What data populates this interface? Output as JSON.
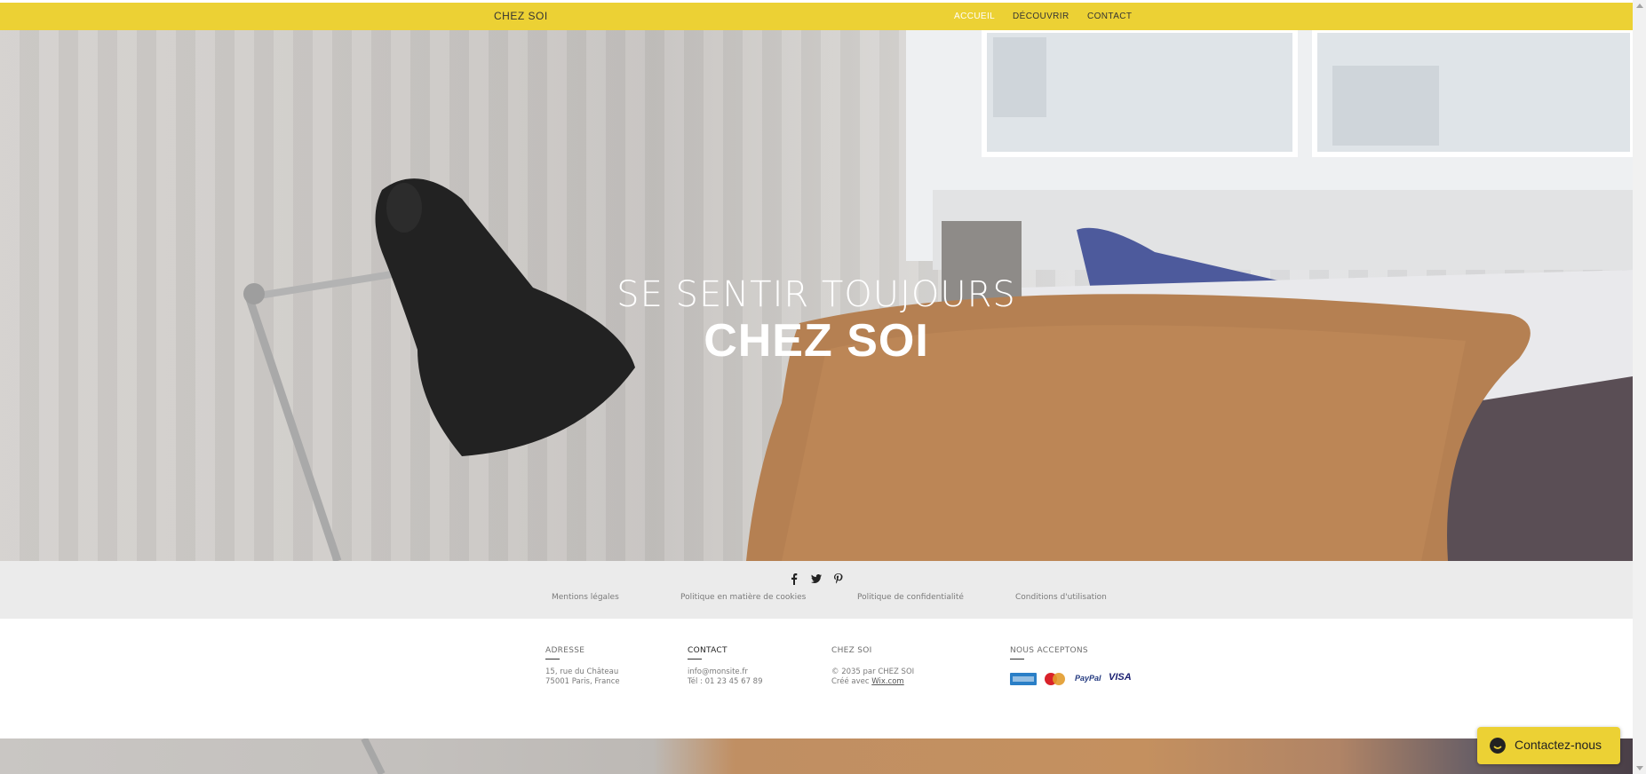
{
  "header": {
    "logo": "CHEZ SOI",
    "nav": [
      {
        "label": "ACCUEIL",
        "active": true
      },
      {
        "label": "DÉCOUVRIR",
        "active": false
      },
      {
        "label": "CONTACT",
        "active": false
      }
    ]
  },
  "hero": {
    "line1": "SE SENTIR TOUJOURS",
    "line2": "CHEZ SOI"
  },
  "social": {
    "icons": [
      "facebook-icon",
      "twitter-icon",
      "pinterest-icon"
    ]
  },
  "legal_links": [
    "Mentions légales",
    "Politique en matière de cookies",
    "Politique de confidentialité",
    "Conditions d'utilisation"
  ],
  "footer": {
    "address": {
      "title": "ADRESSE",
      "line1": "15, rue du Château",
      "line2": "75001 Paris, France"
    },
    "contact": {
      "title": "CONTACT",
      "email": "info@monsite.fr",
      "phone": "Tél : 01 23 45 67 89"
    },
    "brand": {
      "title": "CHEZ SOI",
      "copyright": "© 2035 par CHEZ SOI",
      "made_with_prefix": "Créé avec ",
      "made_with_link": "Wix.com"
    },
    "payments": {
      "title": "NOUS ACCEPTONS",
      "visa": "VISA",
      "paypal": "PayPal"
    }
  },
  "chat": {
    "label": "Contactez-nous"
  },
  "colors": {
    "accent": "#ecd134",
    "band": "#ebebeb"
  }
}
